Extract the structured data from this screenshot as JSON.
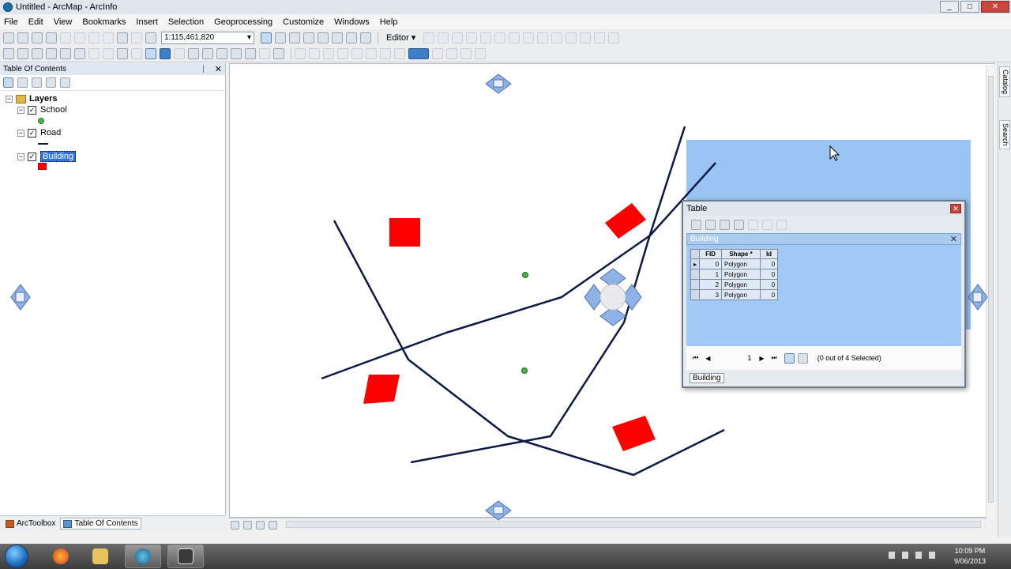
{
  "window": {
    "title": "Untitled - ArcMap - ArcInfo",
    "minimize": "_",
    "maximize": "□",
    "close": "✕"
  },
  "menu": [
    "File",
    "Edit",
    "View",
    "Bookmarks",
    "Insert",
    "Selection",
    "Geoprocessing",
    "Customize",
    "Windows",
    "Help"
  ],
  "toolbar": {
    "scale": "1:115,461,820",
    "editor_label": "Editor ▾"
  },
  "toc": {
    "title": "Table Of Contents",
    "pin": "ᛁ",
    "close": "✕",
    "root": "Layers",
    "layers": [
      {
        "name": "School",
        "symbol": "point",
        "color": "#4db04a"
      },
      {
        "name": "Road",
        "symbol": "line",
        "color": "#0e1a45"
      },
      {
        "name": "Building",
        "symbol": "polygon",
        "color": "#ff0000"
      }
    ]
  },
  "bottom_tabs": [
    "ArcToolbox",
    "Table Of Contents"
  ],
  "side_tabs": [
    "Catalog",
    "Search"
  ],
  "table_window": {
    "title": "Table",
    "close": "✕",
    "tab": "Building",
    "tab_close": "✕",
    "columns": [
      "FID",
      "Shape *",
      "Id"
    ],
    "rows": [
      [
        "0",
        "Polygon",
        "0"
      ],
      [
        "1",
        "Polygon",
        "0"
      ],
      [
        "2",
        "Polygon",
        "0"
      ],
      [
        "3",
        "Polygon",
        "0"
      ]
    ],
    "page": "1",
    "selection_status": "(0 out of 4 Selected)",
    "footer_tab": "Building"
  },
  "map": {
    "road_color": "#0e1a45",
    "building_color": "#ff0000",
    "school_color": "#4db04a",
    "dock_overlay_color": "#7fb5f0"
  },
  "clock": {
    "time": "10:09 PM",
    "date": "9/06/2013"
  }
}
